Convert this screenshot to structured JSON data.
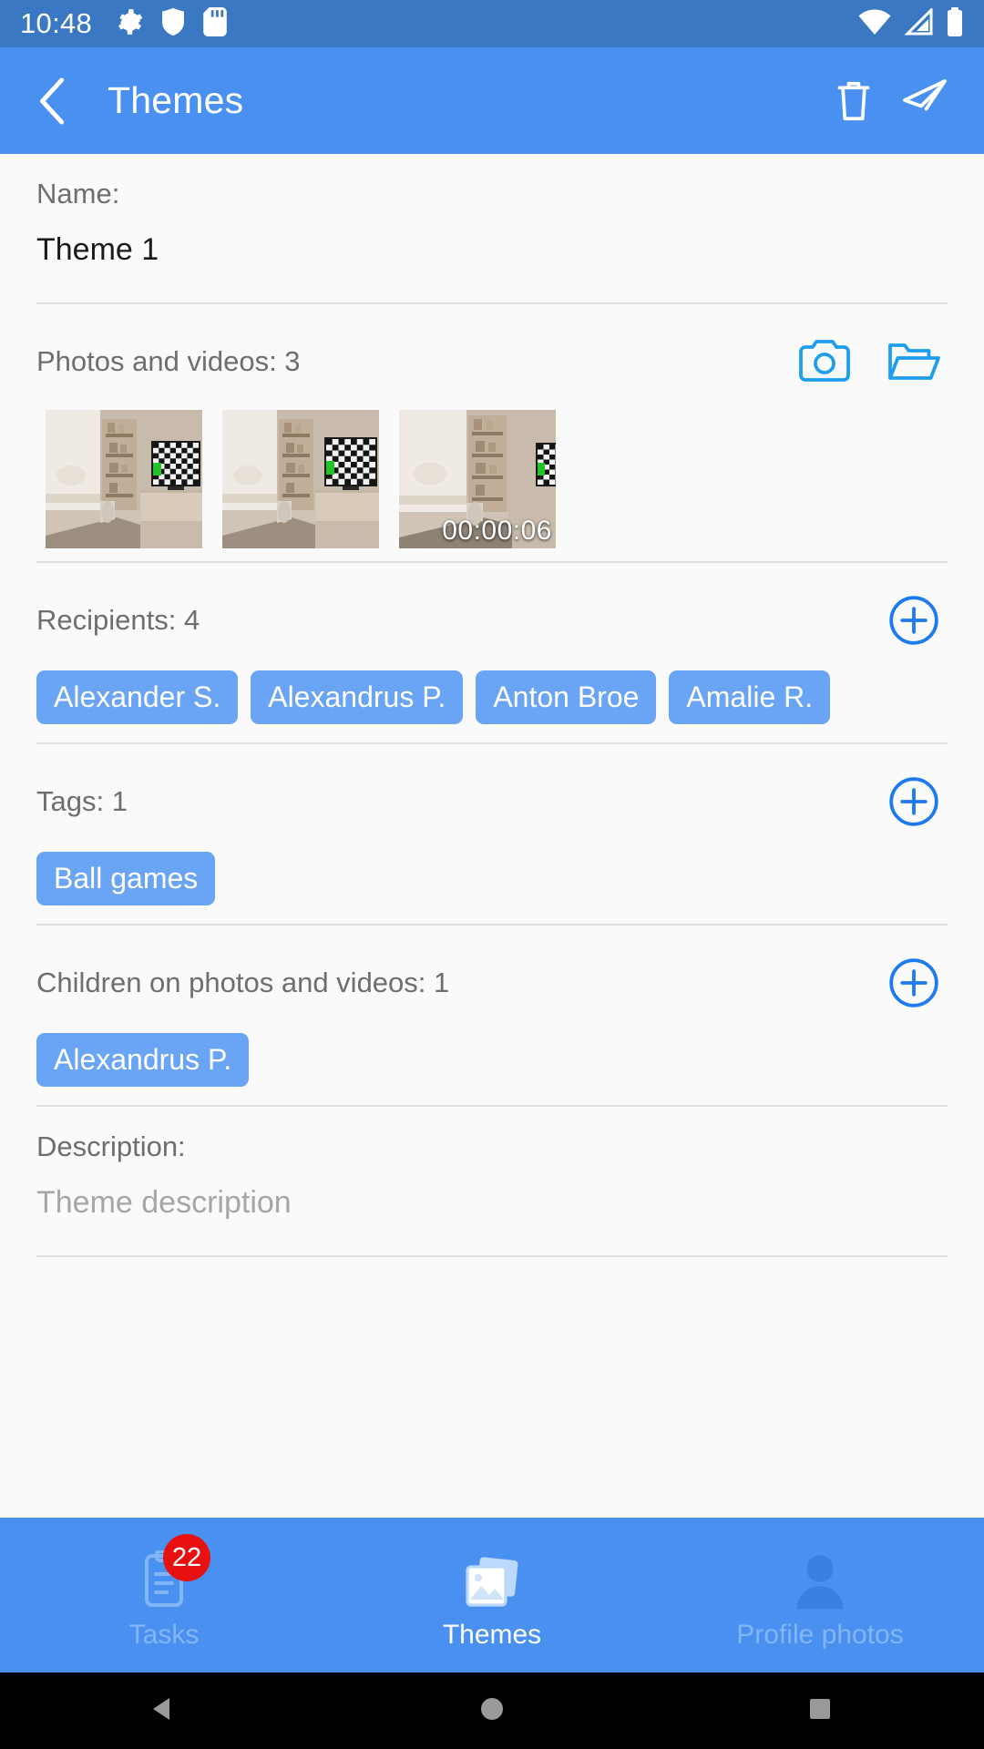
{
  "status_bar": {
    "time": "10:48",
    "left_icons": [
      "gear-icon",
      "shield-icon",
      "sd-card-icon"
    ],
    "right_icons": [
      "wifi-icon",
      "signal-icon",
      "battery-icon"
    ],
    "background": "#3b78c4"
  },
  "app_bar": {
    "title": "Themes",
    "back_icon": "chevron-left-icon",
    "delete_icon": "trash-icon",
    "send_icon": "send-icon",
    "background": "#4a90f0"
  },
  "form": {
    "name": {
      "label": "Name:",
      "value": "Theme 1"
    },
    "media": {
      "label": "Photos and videos: 3",
      "count": 3,
      "camera_icon": "camera-icon",
      "folder_icon": "folder-icon",
      "items": [
        {
          "type": "photo",
          "duration": ""
        },
        {
          "type": "photo",
          "duration": ""
        },
        {
          "type": "video",
          "duration": "00:00:06"
        }
      ]
    },
    "recipients": {
      "label": "Recipients: 4",
      "count": 4,
      "add_icon": "plus-circle-icon",
      "chips": [
        "Alexander S.",
        "Alexandrus P.",
        "Anton Broe",
        "Amalie R."
      ]
    },
    "tags": {
      "label": "Tags: 1",
      "count": 1,
      "add_icon": "plus-circle-icon",
      "chips": [
        "Ball games"
      ]
    },
    "children": {
      "label": "Children on photos and videos: 1",
      "count": 1,
      "add_icon": "plus-circle-icon",
      "chips": [
        "Alexandrus P."
      ]
    },
    "description": {
      "label": "Description:",
      "placeholder": "Theme description",
      "value": ""
    }
  },
  "bottom_nav": {
    "items": [
      {
        "label": "Tasks",
        "icon": "clipboard-icon",
        "badge": "22",
        "active": false
      },
      {
        "label": "Themes",
        "icon": "photos-icon",
        "badge": "",
        "active": true
      },
      {
        "label": "Profile photos",
        "icon": "person-icon",
        "badge": "",
        "active": false
      }
    ]
  },
  "system_nav": {
    "back_icon": "triangle-back-icon",
    "home_icon": "circle-home-icon",
    "recents_icon": "square-recents-icon"
  },
  "colors": {
    "accent": "#4a90f0",
    "chip": "#6aa4f4",
    "icon_blue": "#1e9ef0",
    "badge_red": "#e81010",
    "page_bg": "#fafafa"
  }
}
